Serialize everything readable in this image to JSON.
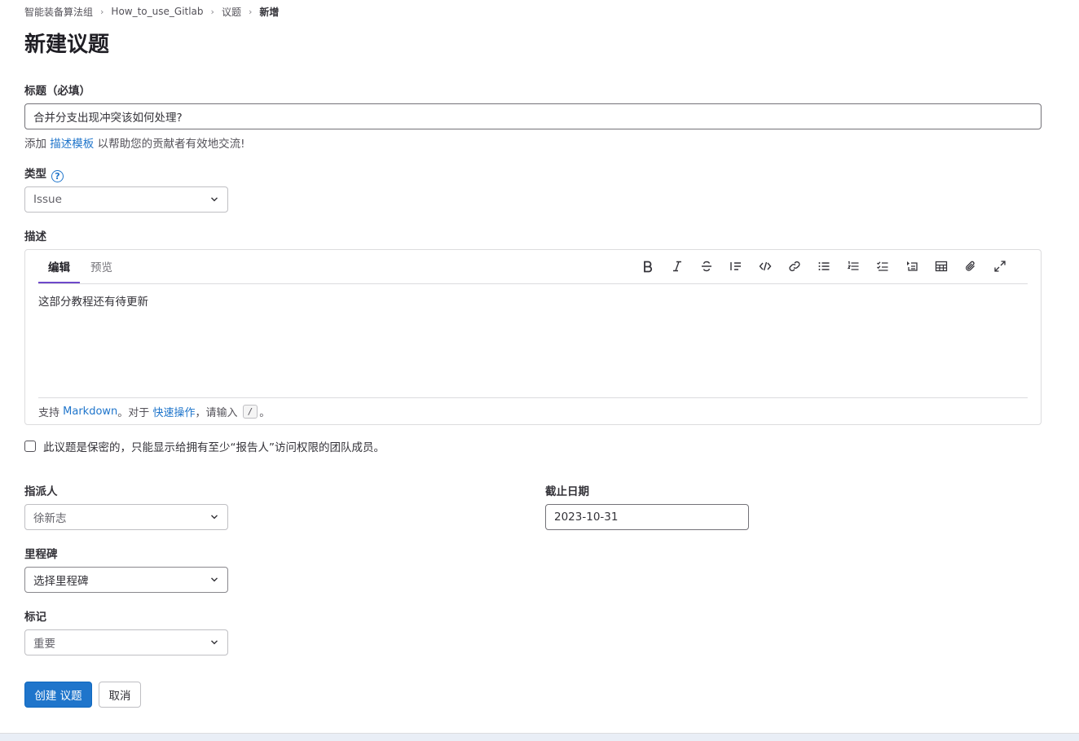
{
  "breadcrumb": {
    "items": [
      "智能装备算法组",
      "How_to_use_Gitlab",
      "议题"
    ],
    "current": "新增"
  },
  "page_title": "新建议题",
  "title_field": {
    "label": "标题（必填）",
    "value": "合并分支出现冲突该如何处理?"
  },
  "template_hint": {
    "prefix": "添加",
    "link": "描述模板",
    "suffix": "以帮助您的贡献者有效地交流!"
  },
  "type_field": {
    "label": "类型",
    "help_icon": "?",
    "value": "Issue"
  },
  "description": {
    "label": "描述",
    "tabs": {
      "edit": "编辑",
      "preview": "预览"
    },
    "toolbar_icons": [
      "bold-icon",
      "italic-icon",
      "strikethrough-icon",
      "quote-icon",
      "code-icon",
      "link-icon",
      "bullet-list-icon",
      "numbered-list-icon",
      "task-list-icon",
      "collapsible-icon",
      "table-icon",
      "attach-icon",
      "fullscreen-icon"
    ],
    "content": "这部分教程还有待更新",
    "footer": {
      "support": "支持",
      "markdown_link": "Markdown",
      "mid": "。对于",
      "quick_actions_link": "快速操作",
      "enter": "，请输入",
      "key": "/",
      "end": "。"
    }
  },
  "confidential": {
    "label": "此议题是保密的，只能显示给拥有至少“报告人”访问权限的团队成员。",
    "checked": false
  },
  "assignee": {
    "label": "指派人",
    "value": "徐新志"
  },
  "due_date": {
    "label": "截止日期",
    "value": "2023-10-31"
  },
  "milestone": {
    "label": "里程碑",
    "value": "选择里程碑"
  },
  "labels": {
    "label": "标记",
    "value": "重要"
  },
  "actions": {
    "create": "创建 议题",
    "cancel": "取消"
  },
  "colors": {
    "primary": "#1f75cb",
    "active_tab": "#6e49cb"
  }
}
